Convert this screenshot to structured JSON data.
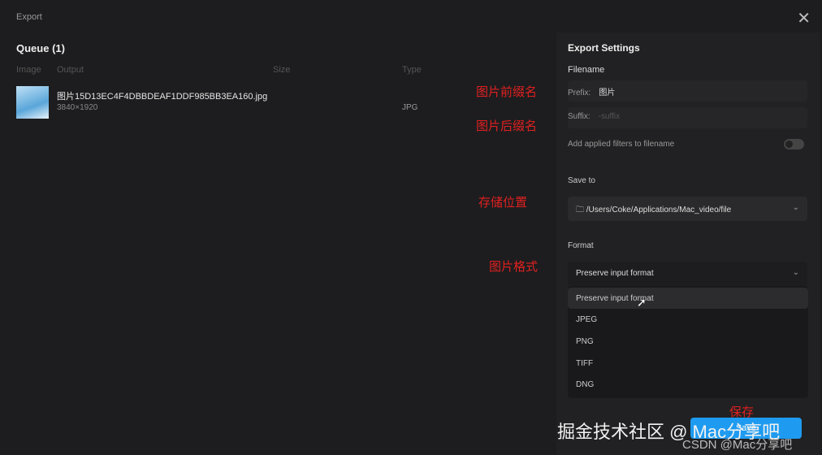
{
  "window": {
    "title": "Export"
  },
  "queue": {
    "title": "Queue (1)",
    "columns": [
      "Image",
      "Output",
      "Size",
      "Type"
    ],
    "items": [
      {
        "filename": "图片15D13EC4F4DBBDEAF1DDF985BB3EA160.jpg",
        "dimensions": "3840×1920",
        "type": "JPG"
      }
    ]
  },
  "settings": {
    "title": "Export Settings",
    "filename_label": "Filename",
    "prefix_label": "Prefix:",
    "prefix_value": "图片",
    "suffix_label": "Suffix:",
    "suffix_placeholder": "-suffix",
    "filters_label": "Add applied filters to filename",
    "filters_on": false,
    "save_to_label": "Save to",
    "save_path": "/Users/Coke/Applications/Mac_video/file",
    "format_label": "Format",
    "format_value": "Preserve input format",
    "format_options": [
      "Preserve input format",
      "JPEG",
      "PNG",
      "TIFF",
      "DNG"
    ],
    "save_button": "Save"
  },
  "annotations": {
    "prefix": "图片前缀名",
    "suffix": "图片后缀名",
    "location": "存储位置",
    "format": "图片格式",
    "save": "保存"
  },
  "watermarks": {
    "juejin": "掘金技术社区 @ Mac分享吧",
    "csdn": "CSDN @Mac分享吧"
  }
}
